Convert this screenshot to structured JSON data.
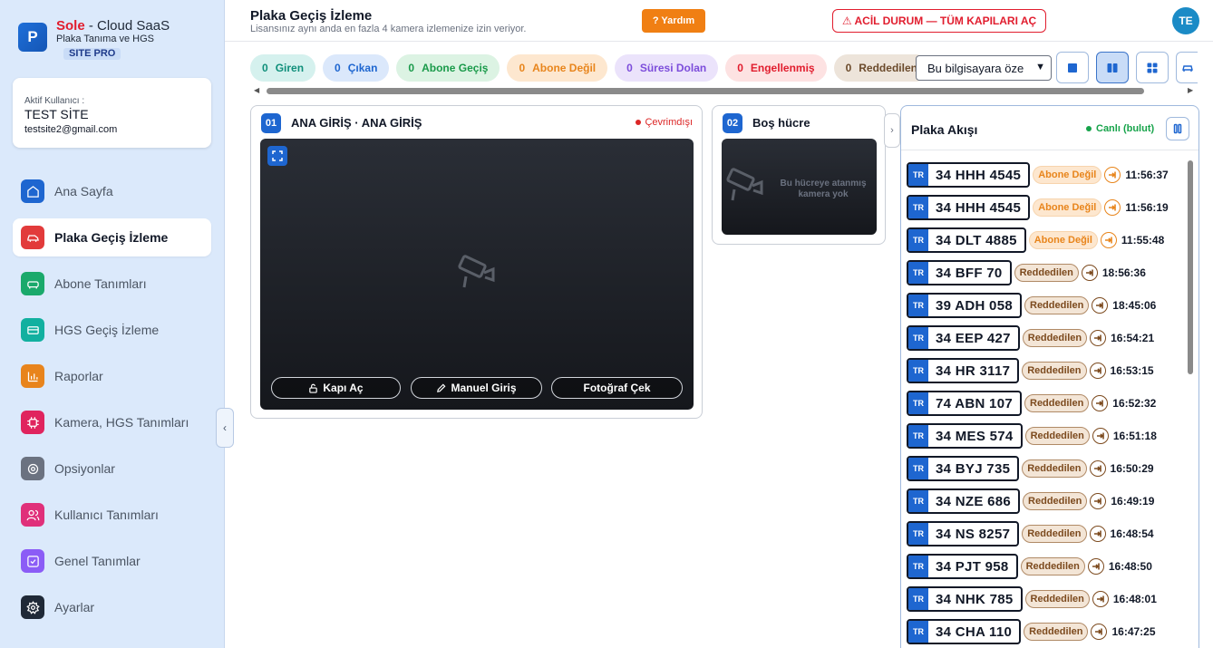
{
  "brand": {
    "logo_letter": "P",
    "name_part1": "Sole",
    "name_part2": " - Cloud SaaS",
    "subtitle": "Plaka Tanıma ve HGS",
    "badge": "SITE PRO"
  },
  "user": {
    "label": "Aktif Kullanıcı :",
    "name": "TEST SİTE",
    "email": "testsite2@gmail.com"
  },
  "nav": [
    {
      "label": "Ana Sayfa",
      "color": "#1e66d0",
      "icon": "home-icon"
    },
    {
      "label": "Plaka Geçiş İzleme",
      "color": "#e23b3b",
      "icon": "car-icon",
      "active": true
    },
    {
      "label": "Abone Tanımları",
      "color": "#1aa96b",
      "icon": "vehicle-icon"
    },
    {
      "label": "HGS Geçiş İzleme",
      "color": "#12b0a0",
      "icon": "card-icon"
    },
    {
      "label": "Raporlar",
      "color": "#e8841c",
      "icon": "chart-icon"
    },
    {
      "label": "Kamera, HGS Tanımları",
      "color": "#e0245e",
      "icon": "chip-icon"
    },
    {
      "label": "Opsiyonlar",
      "color": "#6b7280",
      "icon": "gear-icon"
    },
    {
      "label": "Kullanıcı Tanımları",
      "color": "#e0307a",
      "icon": "users-icon"
    },
    {
      "label": "Genel Tanımlar",
      "color": "#8b5cf6",
      "icon": "check-square-icon"
    },
    {
      "label": "Ayarlar",
      "color": "#1f2937",
      "icon": "settings-icon"
    }
  ],
  "header": {
    "title": "Plaka Geçiş İzleme",
    "subtitle": "Lisansınız aynı anda en fazla 4 kamera izlemenize izin veriyor.",
    "help": "? Yardım",
    "emergency": "⚠ ACİL DURUM — TÜM KAPILARI AÇ",
    "avatar": "TE"
  },
  "filters": [
    {
      "count": "0",
      "label": "Giren",
      "bg": "#d5f1ee",
      "fg": "#0f8f7a"
    },
    {
      "count": "0",
      "label": "Çıkan",
      "bg": "#dbe8fb",
      "fg": "#1e66d0"
    },
    {
      "count": "0",
      "label": "Abone Geçiş",
      "bg": "#dcf3e3",
      "fg": "#1a9a4a"
    },
    {
      "count": "0",
      "label": "Abone Değil",
      "bg": "#fde7cf",
      "fg": "#e8851c"
    },
    {
      "count": "0",
      "label": "Süresi Dolan",
      "bg": "#ebe3fb",
      "fg": "#7c4ddb"
    },
    {
      "count": "0",
      "label": "Engellenmiş",
      "bg": "#fde2e2",
      "fg": "#e11d2e"
    },
    {
      "count": "0",
      "label": "Reddedilen",
      "bg": "#ede4da",
      "fg": "#6b4a2b"
    }
  ],
  "select": {
    "value": "Bu bilgisayara öze"
  },
  "cells": [
    {
      "num": "01",
      "title": "ANA GİRİŞ · ANA GİRİŞ",
      "status": "Çevrimdışı",
      "actions": {
        "open": "Kapı Aç",
        "manual": "Manuel Giriş",
        "photo": "Fotoğraf Çek"
      }
    },
    {
      "num": "02",
      "title": "Boş hücre",
      "empty_text": "Bu hücreye atanmış kamera yok"
    }
  ],
  "feed": {
    "title": "Plaka Akışı",
    "live": "Canlı (bulut)",
    "country": "TR",
    "items": [
      {
        "plate": "34 HHH 4545",
        "status": "Abone Değil",
        "type": "abone",
        "time": "11:56:37"
      },
      {
        "plate": "34 HHH 4545",
        "status": "Abone Değil",
        "type": "abone",
        "time": "11:56:19"
      },
      {
        "plate": "34 DLT 4885",
        "status": "Abone Değil",
        "type": "abone",
        "time": "11:55:48"
      },
      {
        "plate": "34 BFF 70",
        "status": "Reddedilen",
        "type": "red",
        "time": "18:56:36"
      },
      {
        "plate": "39 ADH 058",
        "status": "Reddedilen",
        "type": "red",
        "time": "18:45:06"
      },
      {
        "plate": "34 EEP 427",
        "status": "Reddedilen",
        "type": "red",
        "time": "16:54:21"
      },
      {
        "plate": "34 HR 3117",
        "status": "Reddedilen",
        "type": "red",
        "time": "16:53:15"
      },
      {
        "plate": "74 ABN 107",
        "status": "Reddedilen",
        "type": "red",
        "time": "16:52:32"
      },
      {
        "plate": "34 MES 574",
        "status": "Reddedilen",
        "type": "red",
        "time": "16:51:18"
      },
      {
        "plate": "34 BYJ 735",
        "status": "Reddedilen",
        "type": "red",
        "time": "16:50:29"
      },
      {
        "plate": "34 NZE 686",
        "status": "Reddedilen",
        "type": "red",
        "time": "16:49:19"
      },
      {
        "plate": "34 NS 8257",
        "status": "Reddedilen",
        "type": "red",
        "time": "16:48:54"
      },
      {
        "plate": "34 PJT 958",
        "status": "Reddedilen",
        "type": "red",
        "time": "16:48:50"
      },
      {
        "plate": "34 NHK 785",
        "status": "Reddedilen",
        "type": "red",
        "time": "16:48:01"
      },
      {
        "plate": "34 CHA 110",
        "status": "Reddedilen",
        "type": "red",
        "time": "16:47:25"
      }
    ]
  }
}
